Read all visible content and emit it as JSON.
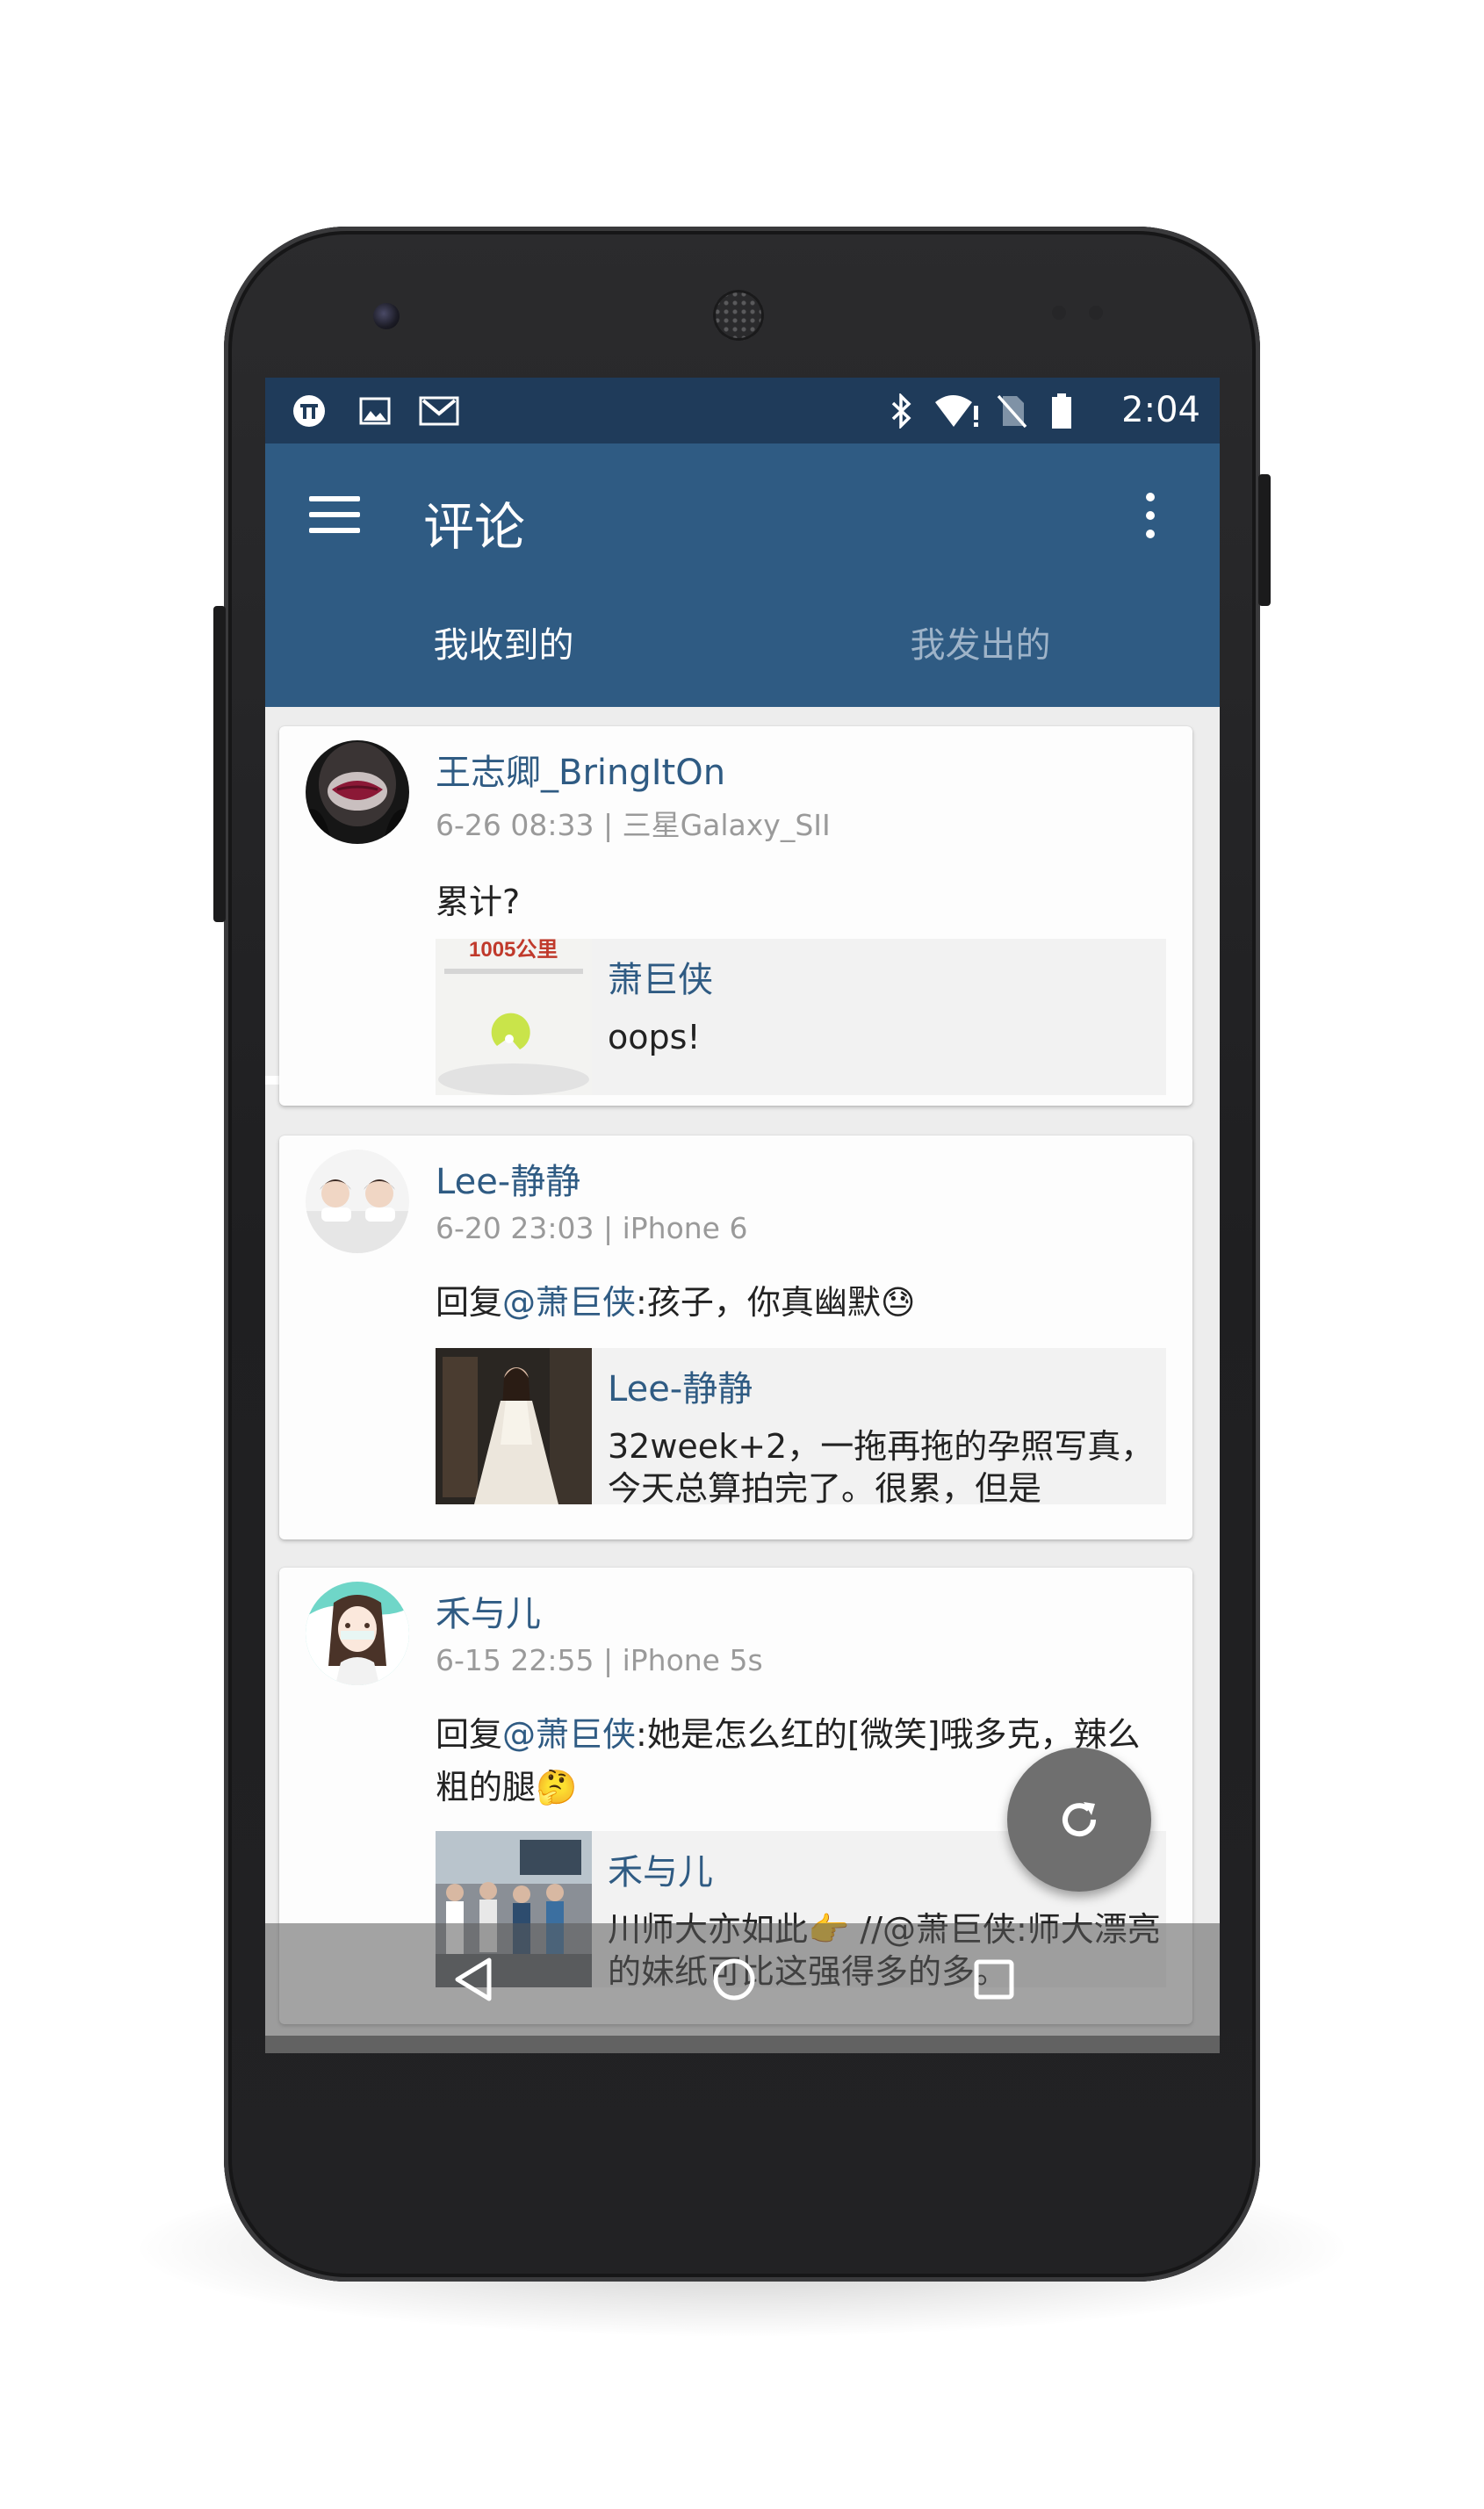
{
  "status_bar": {
    "time": "2:04",
    "left_icons": [
      "pi-icon",
      "image-icon",
      "gmail-icon"
    ],
    "right_icons": [
      "bluetooth-icon",
      "wifi-icon",
      "no-sim-icon",
      "battery-icon"
    ]
  },
  "app_bar": {
    "title": "评论",
    "tabs": [
      {
        "label": "我收到的",
        "active": true
      },
      {
        "label": "我发出的",
        "active": false
      }
    ]
  },
  "comments": [
    {
      "username": "王志卿_BringItOn",
      "meta": "6-26 08:33 | 三星Galaxy_SII",
      "text": "累计?",
      "quote": {
        "author": "萧巨侠",
        "text": "oops!",
        "thumb_text": "1005公里"
      }
    },
    {
      "username": "Lee-静静",
      "meta": "6-20 23:03 | iPhone 6",
      "text_prefix": "回复",
      "mention": "@萧巨侠",
      "text_suffix": ":孩子，你真幽默😓",
      "quote": {
        "author": "Lee-静静",
        "text": "32week+2，一拖再拖的孕照写真，今天总算拍完了。很累，但是"
      }
    },
    {
      "username": "禾与儿",
      "meta": "6-15 22:55 | iPhone 5s",
      "text_prefix": "回复",
      "mention": "@萧巨侠",
      "text_suffix": ":她是怎么红的[微笑]哦多克，辣么粗的腿🤔",
      "quote": {
        "author": "禾与儿",
        "text": "川师大亦如此👉 //@萧巨侠:师大漂亮的妹纸可比这强得多的多。"
      }
    }
  ],
  "fab": {
    "icon": "refresh-icon"
  },
  "nav_bar": {
    "icons": [
      "back-icon",
      "home-icon",
      "recents-icon"
    ]
  },
  "colors": {
    "status_bar": "#1f3b5a",
    "app_bar": "#2f5b83",
    "link": "#2f5b83",
    "fab": "#6f6f6f"
  }
}
